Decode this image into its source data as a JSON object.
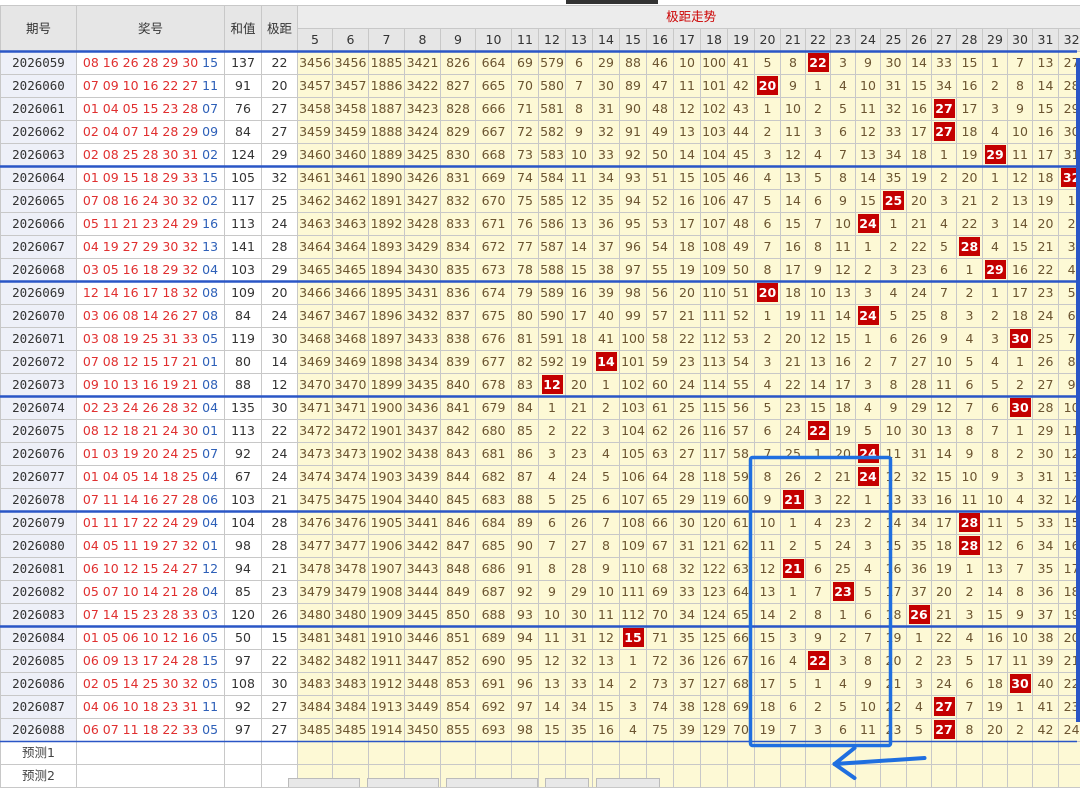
{
  "header": {
    "issue": "期号",
    "draw": "奖号",
    "sum": "和值",
    "span": "极距",
    "trend_title": "极距走势"
  },
  "chart_data": {
    "type": "table",
    "columns": [
      5,
      6,
      7,
      8,
      9,
      10,
      11,
      12,
      13,
      14,
      15,
      16,
      17,
      18,
      19,
      20,
      21,
      22,
      23,
      24,
      25,
      26,
      27,
      28,
      29,
      30,
      31,
      32
    ],
    "rows": [
      {
        "issue": "2026059",
        "red": "08 16 26 28 29 30",
        "blue": "15",
        "sum": "137",
        "span": "22",
        "cells": [
          "3456",
          "3456",
          "1885",
          "3421",
          "826",
          "664",
          "69",
          "579",
          "6",
          "29",
          "88",
          "46",
          "10",
          "100",
          "41",
          "5",
          "8",
          "22",
          "3",
          "9",
          "30",
          "14",
          "33",
          "15",
          "1",
          "7",
          "13",
          "27"
        ]
      },
      {
        "issue": "2026060",
        "red": "07 09 10 16 22 27",
        "blue": "11",
        "sum": "91",
        "span": "20",
        "cells": [
          "3457",
          "3457",
          "1886",
          "3422",
          "827",
          "665",
          "70",
          "580",
          "7",
          "30",
          "89",
          "47",
          "11",
          "101",
          "42",
          "20",
          "9",
          "1",
          "4",
          "10",
          "31",
          "15",
          "34",
          "16",
          "2",
          "8",
          "14",
          "28"
        ]
      },
      {
        "issue": "2026061",
        "red": "01 04 05 15 23 28",
        "blue": "07",
        "sum": "76",
        "span": "27",
        "cells": [
          "3458",
          "3458",
          "1887",
          "3423",
          "828",
          "666",
          "71",
          "581",
          "8",
          "31",
          "90",
          "48",
          "12",
          "102",
          "43",
          "1",
          "10",
          "2",
          "5",
          "11",
          "32",
          "16",
          "27",
          "17",
          "3",
          "9",
          "15",
          "29"
        ]
      },
      {
        "issue": "2026062",
        "red": "02 04 07 14 28 29",
        "blue": "09",
        "sum": "84",
        "span": "27",
        "cells": [
          "3459",
          "3459",
          "1888",
          "3424",
          "829",
          "667",
          "72",
          "582",
          "9",
          "32",
          "91",
          "49",
          "13",
          "103",
          "44",
          "2",
          "11",
          "3",
          "6",
          "12",
          "33",
          "17",
          "27",
          "18",
          "4",
          "10",
          "16",
          "30"
        ]
      },
      {
        "issue": "2026063",
        "red": "02 08 25 28 30 31",
        "blue": "02",
        "sum": "124",
        "span": "29",
        "cells": [
          "3460",
          "3460",
          "1889",
          "3425",
          "830",
          "668",
          "73",
          "583",
          "10",
          "33",
          "92",
          "50",
          "14",
          "104",
          "45",
          "3",
          "12",
          "4",
          "7",
          "13",
          "34",
          "18",
          "1",
          "19",
          "29",
          "11",
          "17",
          "31"
        ]
      },
      {
        "issue": "2026064",
        "red": "01 09 15 18 29 33",
        "blue": "15",
        "sum": "105",
        "span": "32",
        "cells": [
          "3461",
          "3461",
          "1890",
          "3426",
          "831",
          "669",
          "74",
          "584",
          "11",
          "34",
          "93",
          "51",
          "15",
          "105",
          "46",
          "4",
          "13",
          "5",
          "8",
          "14",
          "35",
          "19",
          "2",
          "20",
          "1",
          "12",
          "18",
          "32"
        ]
      },
      {
        "issue": "2026065",
        "red": "07 08 16 24 30 32",
        "blue": "02",
        "sum": "117",
        "span": "25",
        "cells": [
          "3462",
          "3462",
          "1891",
          "3427",
          "832",
          "670",
          "75",
          "585",
          "12",
          "35",
          "94",
          "52",
          "16",
          "106",
          "47",
          "5",
          "14",
          "6",
          "9",
          "15",
          "25",
          "20",
          "3",
          "21",
          "2",
          "13",
          "19",
          "1"
        ]
      },
      {
        "issue": "2026066",
        "red": "05 11 21 23 24 29",
        "blue": "16",
        "sum": "113",
        "span": "24",
        "cells": [
          "3463",
          "3463",
          "1892",
          "3428",
          "833",
          "671",
          "76",
          "586",
          "13",
          "36",
          "95",
          "53",
          "17",
          "107",
          "48",
          "6",
          "15",
          "7",
          "10",
          "24",
          "1",
          "21",
          "4",
          "22",
          "3",
          "14",
          "20",
          "2"
        ]
      },
      {
        "issue": "2026067",
        "red": "04 19 27 29 30 32",
        "blue": "13",
        "sum": "141",
        "span": "28",
        "cells": [
          "3464",
          "3464",
          "1893",
          "3429",
          "834",
          "672",
          "77",
          "587",
          "14",
          "37",
          "96",
          "54",
          "18",
          "108",
          "49",
          "7",
          "16",
          "8",
          "11",
          "1",
          "2",
          "22",
          "5",
          "28",
          "4",
          "15",
          "21",
          "3"
        ]
      },
      {
        "issue": "2026068",
        "red": "03 05 16 18 29 32",
        "blue": "04",
        "sum": "103",
        "span": "29",
        "cells": [
          "3465",
          "3465",
          "1894",
          "3430",
          "835",
          "673",
          "78",
          "588",
          "15",
          "38",
          "97",
          "55",
          "19",
          "109",
          "50",
          "8",
          "17",
          "9",
          "12",
          "2",
          "3",
          "23",
          "6",
          "1",
          "29",
          "16",
          "22",
          "4"
        ]
      },
      {
        "issue": "2026069",
        "red": "12 14 16 17 18 32",
        "blue": "08",
        "sum": "109",
        "span": "20",
        "cells": [
          "3466",
          "3466",
          "1895",
          "3431",
          "836",
          "674",
          "79",
          "589",
          "16",
          "39",
          "98",
          "56",
          "20",
          "110",
          "51",
          "20",
          "18",
          "10",
          "13",
          "3",
          "4",
          "24",
          "7",
          "2",
          "1",
          "17",
          "23",
          "5"
        ]
      },
      {
        "issue": "2026070",
        "red": "03 06 08 14 26 27",
        "blue": "08",
        "sum": "84",
        "span": "24",
        "cells": [
          "3467",
          "3467",
          "1896",
          "3432",
          "837",
          "675",
          "80",
          "590",
          "17",
          "40",
          "99",
          "57",
          "21",
          "111",
          "52",
          "1",
          "19",
          "11",
          "14",
          "24",
          "5",
          "25",
          "8",
          "3",
          "2",
          "18",
          "24",
          "6"
        ]
      },
      {
        "issue": "2026071",
        "red": "03 08 19 25 31 33",
        "blue": "05",
        "sum": "119",
        "span": "30",
        "cells": [
          "3468",
          "3468",
          "1897",
          "3433",
          "838",
          "676",
          "81",
          "591",
          "18",
          "41",
          "100",
          "58",
          "22",
          "112",
          "53",
          "2",
          "20",
          "12",
          "15",
          "1",
          "6",
          "26",
          "9",
          "4",
          "3",
          "30",
          "25",
          "7"
        ]
      },
      {
        "issue": "2026072",
        "red": "07 08 12 15 17 21",
        "blue": "01",
        "sum": "80",
        "span": "14",
        "cells": [
          "3469",
          "3469",
          "1898",
          "3434",
          "839",
          "677",
          "82",
          "592",
          "19",
          "14",
          "101",
          "59",
          "23",
          "113",
          "54",
          "3",
          "21",
          "13",
          "16",
          "2",
          "7",
          "27",
          "10",
          "5",
          "4",
          "1",
          "26",
          "8"
        ]
      },
      {
        "issue": "2026073",
        "red": "09 10 13 16 19 21",
        "blue": "08",
        "sum": "88",
        "span": "12",
        "cells": [
          "3470",
          "3470",
          "1899",
          "3435",
          "840",
          "678",
          "83",
          "12",
          "20",
          "1",
          "102",
          "60",
          "24",
          "114",
          "55",
          "4",
          "22",
          "14",
          "17",
          "3",
          "8",
          "28",
          "11",
          "6",
          "5",
          "2",
          "27",
          "9"
        ]
      },
      {
        "issue": "2026074",
        "red": "02 23 24 26 28 32",
        "blue": "04",
        "sum": "135",
        "span": "30",
        "cells": [
          "3471",
          "3471",
          "1900",
          "3436",
          "841",
          "679",
          "84",
          "1",
          "21",
          "2",
          "103",
          "61",
          "25",
          "115",
          "56",
          "5",
          "23",
          "15",
          "18",
          "4",
          "9",
          "29",
          "12",
          "7",
          "6",
          "30",
          "28",
          "10"
        ]
      },
      {
        "issue": "2026075",
        "red": "08 12 18 21 24 30",
        "blue": "01",
        "sum": "113",
        "span": "22",
        "cells": [
          "3472",
          "3472",
          "1901",
          "3437",
          "842",
          "680",
          "85",
          "2",
          "22",
          "3",
          "104",
          "62",
          "26",
          "116",
          "57",
          "6",
          "24",
          "22",
          "19",
          "5",
          "10",
          "30",
          "13",
          "8",
          "7",
          "1",
          "29",
          "11"
        ]
      },
      {
        "issue": "2026076",
        "red": "01 03 19 20 24 25",
        "blue": "07",
        "sum": "92",
        "span": "24",
        "cells": [
          "3473",
          "3473",
          "1902",
          "3438",
          "843",
          "681",
          "86",
          "3",
          "23",
          "4",
          "105",
          "63",
          "27",
          "117",
          "58",
          "7",
          "25",
          "1",
          "20",
          "24",
          "11",
          "31",
          "14",
          "9",
          "8",
          "2",
          "30",
          "12"
        ]
      },
      {
        "issue": "2026077",
        "red": "01 04 05 14 18 25",
        "blue": "04",
        "sum": "67",
        "span": "24",
        "cells": [
          "3474",
          "3474",
          "1903",
          "3439",
          "844",
          "682",
          "87",
          "4",
          "24",
          "5",
          "106",
          "64",
          "28",
          "118",
          "59",
          "8",
          "26",
          "2",
          "21",
          "24",
          "12",
          "32",
          "15",
          "10",
          "9",
          "3",
          "31",
          "13"
        ]
      },
      {
        "issue": "2026078",
        "red": "07 11 14 16 27 28",
        "blue": "06",
        "sum": "103",
        "span": "21",
        "cells": [
          "3475",
          "3475",
          "1904",
          "3440",
          "845",
          "683",
          "88",
          "5",
          "25",
          "6",
          "107",
          "65",
          "29",
          "119",
          "60",
          "9",
          "21",
          "3",
          "22",
          "1",
          "13",
          "33",
          "16",
          "11",
          "10",
          "4",
          "32",
          "14"
        ]
      },
      {
        "issue": "2026079",
        "red": "01 11 17 22 24 29",
        "blue": "04",
        "sum": "104",
        "span": "28",
        "cells": [
          "3476",
          "3476",
          "1905",
          "3441",
          "846",
          "684",
          "89",
          "6",
          "26",
          "7",
          "108",
          "66",
          "30",
          "120",
          "61",
          "10",
          "1",
          "4",
          "23",
          "2",
          "14",
          "34",
          "17",
          "28",
          "11",
          "5",
          "33",
          "15"
        ]
      },
      {
        "issue": "2026080",
        "red": "04 05 11 19 27 32",
        "blue": "01",
        "sum": "98",
        "span": "28",
        "cells": [
          "3477",
          "3477",
          "1906",
          "3442",
          "847",
          "685",
          "90",
          "7",
          "27",
          "8",
          "109",
          "67",
          "31",
          "121",
          "62",
          "11",
          "2",
          "5",
          "24",
          "3",
          "15",
          "35",
          "18",
          "28",
          "12",
          "6",
          "34",
          "16"
        ]
      },
      {
        "issue": "2026081",
        "red": "06 10 12 15 24 27",
        "blue": "12",
        "sum": "94",
        "span": "21",
        "cells": [
          "3478",
          "3478",
          "1907",
          "3443",
          "848",
          "686",
          "91",
          "8",
          "28",
          "9",
          "110",
          "68",
          "32",
          "122",
          "63",
          "12",
          "21",
          "6",
          "25",
          "4",
          "16",
          "36",
          "19",
          "1",
          "13",
          "7",
          "35",
          "17"
        ]
      },
      {
        "issue": "2026082",
        "red": "05 07 10 14 21 28",
        "blue": "04",
        "sum": "85",
        "span": "23",
        "cells": [
          "3479",
          "3479",
          "1908",
          "3444",
          "849",
          "687",
          "92",
          "9",
          "29",
          "10",
          "111",
          "69",
          "33",
          "123",
          "64",
          "13",
          "1",
          "7",
          "23",
          "5",
          "17",
          "37",
          "20",
          "2",
          "14",
          "8",
          "36",
          "18"
        ]
      },
      {
        "issue": "2026083",
        "red": "07 14 15 23 28 33",
        "blue": "03",
        "sum": "120",
        "span": "26",
        "cells": [
          "3480",
          "3480",
          "1909",
          "3445",
          "850",
          "688",
          "93",
          "10",
          "30",
          "11",
          "112",
          "70",
          "34",
          "124",
          "65",
          "14",
          "2",
          "8",
          "1",
          "6",
          "18",
          "26",
          "21",
          "3",
          "15",
          "9",
          "37",
          "19"
        ]
      },
      {
        "issue": "2026084",
        "red": "01 05 06 10 12 16",
        "blue": "05",
        "sum": "50",
        "span": "15",
        "cells": [
          "3481",
          "3481",
          "1910",
          "3446",
          "851",
          "689",
          "94",
          "11",
          "31",
          "12",
          "15",
          "71",
          "35",
          "125",
          "66",
          "15",
          "3",
          "9",
          "2",
          "7",
          "19",
          "1",
          "22",
          "4",
          "16",
          "10",
          "38",
          "20"
        ]
      },
      {
        "issue": "2026085",
        "red": "06 09 13 17 24 28",
        "blue": "15",
        "sum": "97",
        "span": "22",
        "cells": [
          "3482",
          "3482",
          "1911",
          "3447",
          "852",
          "690",
          "95",
          "12",
          "32",
          "13",
          "1",
          "72",
          "36",
          "126",
          "67",
          "16",
          "4",
          "22",
          "3",
          "8",
          "20",
          "2",
          "23",
          "5",
          "17",
          "11",
          "39",
          "21"
        ]
      },
      {
        "issue": "2026086",
        "red": "02 05 14 25 30 32",
        "blue": "05",
        "sum": "108",
        "span": "30",
        "cells": [
          "3483",
          "3483",
          "1912",
          "3448",
          "853",
          "691",
          "96",
          "13",
          "33",
          "14",
          "2",
          "73",
          "37",
          "127",
          "68",
          "17",
          "5",
          "1",
          "4",
          "9",
          "21",
          "3",
          "24",
          "6",
          "18",
          "30",
          "40",
          "22"
        ]
      },
      {
        "issue": "2026087",
        "red": "04 06 10 18 23 31",
        "blue": "11",
        "sum": "92",
        "span": "27",
        "cells": [
          "3484",
          "3484",
          "1913",
          "3449",
          "854",
          "692",
          "97",
          "14",
          "34",
          "15",
          "3",
          "74",
          "38",
          "128",
          "69",
          "18",
          "6",
          "2",
          "5",
          "10",
          "22",
          "4",
          "27",
          "7",
          "19",
          "1",
          "41",
          "23"
        ]
      },
      {
        "issue": "2026088",
        "red": "06 07 11 18 22 33",
        "blue": "05",
        "sum": "97",
        "span": "27",
        "cells": [
          "3485",
          "3485",
          "1914",
          "3450",
          "855",
          "693",
          "98",
          "15",
          "35",
          "16",
          "4",
          "75",
          "39",
          "129",
          "70",
          "19",
          "7",
          "3",
          "6",
          "11",
          "23",
          "5",
          "27",
          "8",
          "20",
          "2",
          "42",
          "24"
        ]
      }
    ],
    "prediction_rows": [
      "预测1",
      "预测2"
    ]
  }
}
